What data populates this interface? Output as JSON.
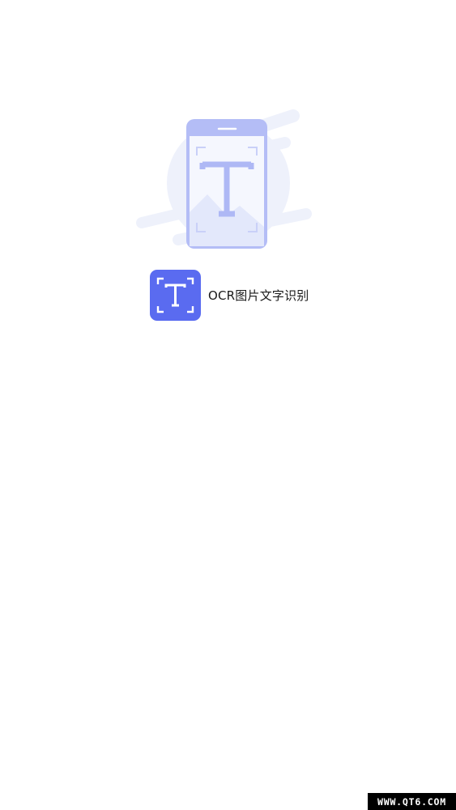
{
  "splash": {
    "illustration_icon": "phone-scan-text-illustration",
    "app_icon": "text-recognition-icon",
    "app_name": "OCR图片文字识别"
  },
  "watermark": {
    "text": "WWW.QT6.COM"
  },
  "colors": {
    "background": "#ffffff",
    "brand": "#5a6bf0",
    "illustration_primary": "#aeb8f5",
    "illustration_light": "#eef1fb"
  }
}
